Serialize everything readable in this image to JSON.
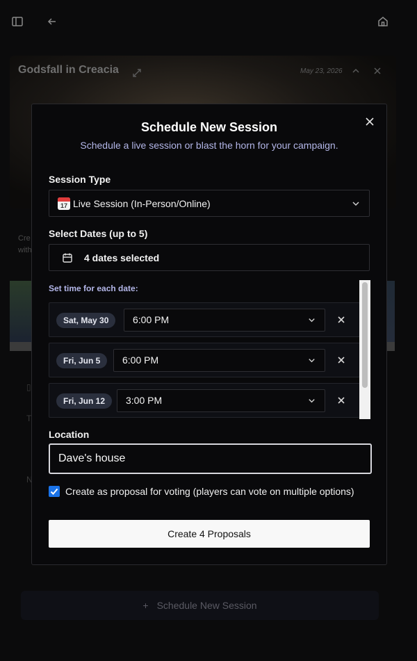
{
  "background": {
    "campaign_title": "Godsfall in Creacia",
    "date": "May 23, 2026",
    "cre_text_1": "Cre",
    "cre_text_2": "with",
    "bottom_button_label": "Schedule New Session"
  },
  "modal": {
    "title": "Schedule New Session",
    "subtitle": "Schedule a live session or blast the horn for your campaign.",
    "session_type_label": "Session Type",
    "session_type_value": "Live Session (In-Person/Online)",
    "session_type_emoji_day": "17",
    "select_dates_label": "Select Dates (up to 5)",
    "dates_selected": "4 dates selected",
    "set_time_label": "Set time for each date:",
    "date_rows": [
      {
        "date": "Sat, May 30",
        "time": "6:00 PM"
      },
      {
        "date": "Fri, Jun 5",
        "time": "6:00 PM"
      },
      {
        "date": "Fri, Jun 12",
        "time": "3:00 PM"
      }
    ],
    "location_label": "Location",
    "location_value": "Dave's house",
    "proposal_checkbox_label": "Create as proposal for voting (players can vote on multiple options)",
    "proposal_checked": true,
    "submit_label": "Create 4 Proposals"
  },
  "colors": {
    "accent_text": "#b3b6e8",
    "checkbox": "#1a73e8",
    "primary_button": "#f8f8f8"
  }
}
